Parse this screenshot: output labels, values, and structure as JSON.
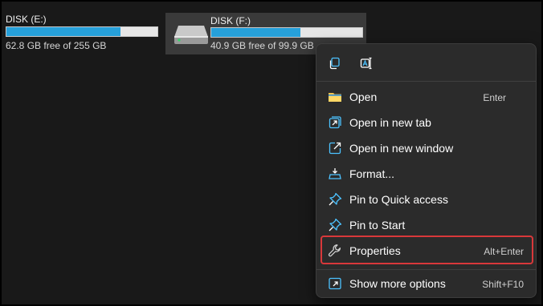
{
  "drives": [
    {
      "name": "DISK (E:)",
      "free_text": "62.8 GB free of 255 GB",
      "used_fraction": 0.754
    },
    {
      "name": "DISK (F:)",
      "free_text": "40.9 GB free of 99.9 GB",
      "used_fraction": 0.59
    }
  ],
  "quick_actions": [
    {
      "icon": "copy-icon"
    },
    {
      "icon": "rename-icon"
    }
  ],
  "menu_items": [
    {
      "label": "Open",
      "shortcut": "Enter",
      "icon": "folder-icon"
    },
    {
      "label": "Open in new tab",
      "shortcut": "",
      "icon": "new-tab-icon"
    },
    {
      "label": "Open in new window",
      "shortcut": "",
      "icon": "new-window-icon"
    },
    {
      "label": "Format...",
      "shortcut": "",
      "icon": "format-icon"
    },
    {
      "label": "Pin to Quick access",
      "shortcut": "",
      "icon": "pin-icon"
    },
    {
      "label": "Pin to Start",
      "shortcut": "",
      "icon": "pin-icon"
    },
    {
      "label": "Properties",
      "shortcut": "Alt+Enter",
      "icon": "wrench-icon"
    },
    {
      "label": "Show more options",
      "shortcut": "Shift+F10",
      "icon": "more-options-icon"
    }
  ],
  "colors": {
    "accent": "#26a0da",
    "highlight": "#d9383a",
    "menu_bg": "#2b2b2b",
    "icon_blue": "#4cc2ff"
  }
}
